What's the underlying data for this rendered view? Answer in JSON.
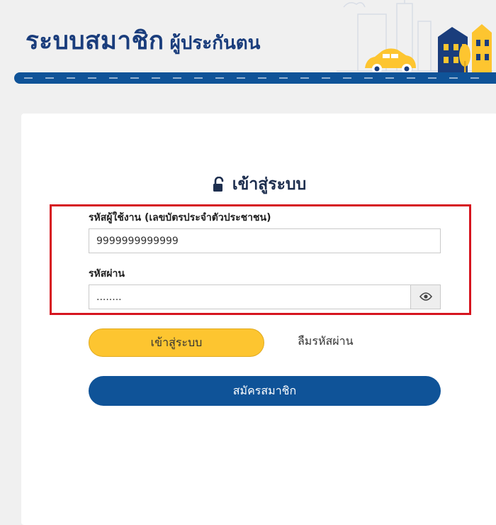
{
  "header": {
    "title": "ระบบสมาชิก",
    "subtitle": "ผู้ประกันตน"
  },
  "login": {
    "heading": "เข้าสู่ระบบ",
    "username_label": "รหัสผู้ใช้งาน (เลขบัตรประจำตัวประชาชน)",
    "username_value": "9999999999999",
    "password_label": "รหัสผ่าน",
    "password_value": "........",
    "login_button": "เข้าสู่ระบบ",
    "forgot_password": "ลืมรหัสผ่าน",
    "register_button": "สมัครสมาชิก"
  },
  "colors": {
    "brand_blue": "#0f5398",
    "title_blue": "#1a3d7c",
    "accent_yellow": "#fdc530",
    "highlight_red": "#d6151f"
  },
  "icons": {
    "lock": "unlock-icon",
    "eye": "eye-icon"
  }
}
